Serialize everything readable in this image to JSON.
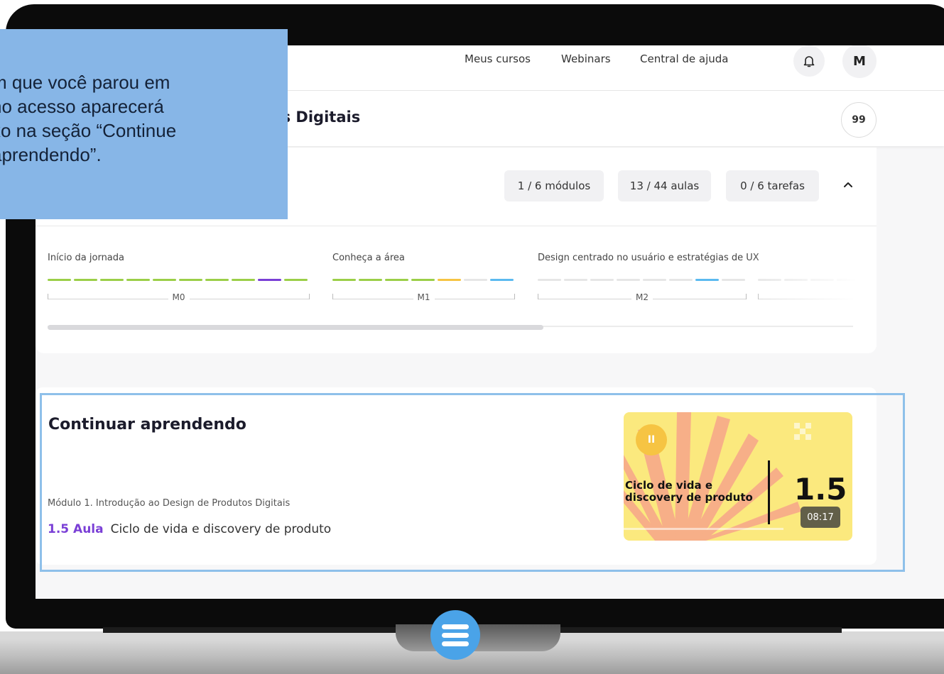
{
  "nav": {
    "links": [
      "Meus cursos",
      "Webinars",
      "Central de ajuda"
    ],
    "avatar_initial": "M"
  },
  "course": {
    "title": "lutos Digitais",
    "quote_label": "99"
  },
  "stats": {
    "modules": "1 / 6 módulos",
    "lessons": "13 / 44 aulas",
    "tasks": "0 / 6 tarefas"
  },
  "journey": {
    "modules": [
      {
        "label": "Início da jornada",
        "code": "M0"
      },
      {
        "label": "Conheça a área",
        "code": "M1"
      },
      {
        "label": "Design centrado no usuário e estratégias de UX",
        "code": "M2"
      }
    ],
    "colors": {
      "done": "#9bcf48",
      "current": "#7a3fd6",
      "partial": "#f6c443",
      "video": "#5bbaf0",
      "pending": "#e6e6e6"
    }
  },
  "continue_section": {
    "title": "Continuar aprendendo",
    "module_path": "Módulo 1. Introdução ao Design de Produtos Digitais",
    "lesson_number": "1.5 Aula",
    "lesson_name": "Ciclo de vida e discovery de produto",
    "thumbnail": {
      "title_line1": "Ciclo de vida e",
      "title_line2": "discovery de produto",
      "number": "1.5",
      "duration": "08:17",
      "play_label": "II"
    }
  },
  "tooltip": {
    "text": "m que você parou em\nno acesso aparecerá\nxo na seção “Continue\naprendendo”."
  }
}
